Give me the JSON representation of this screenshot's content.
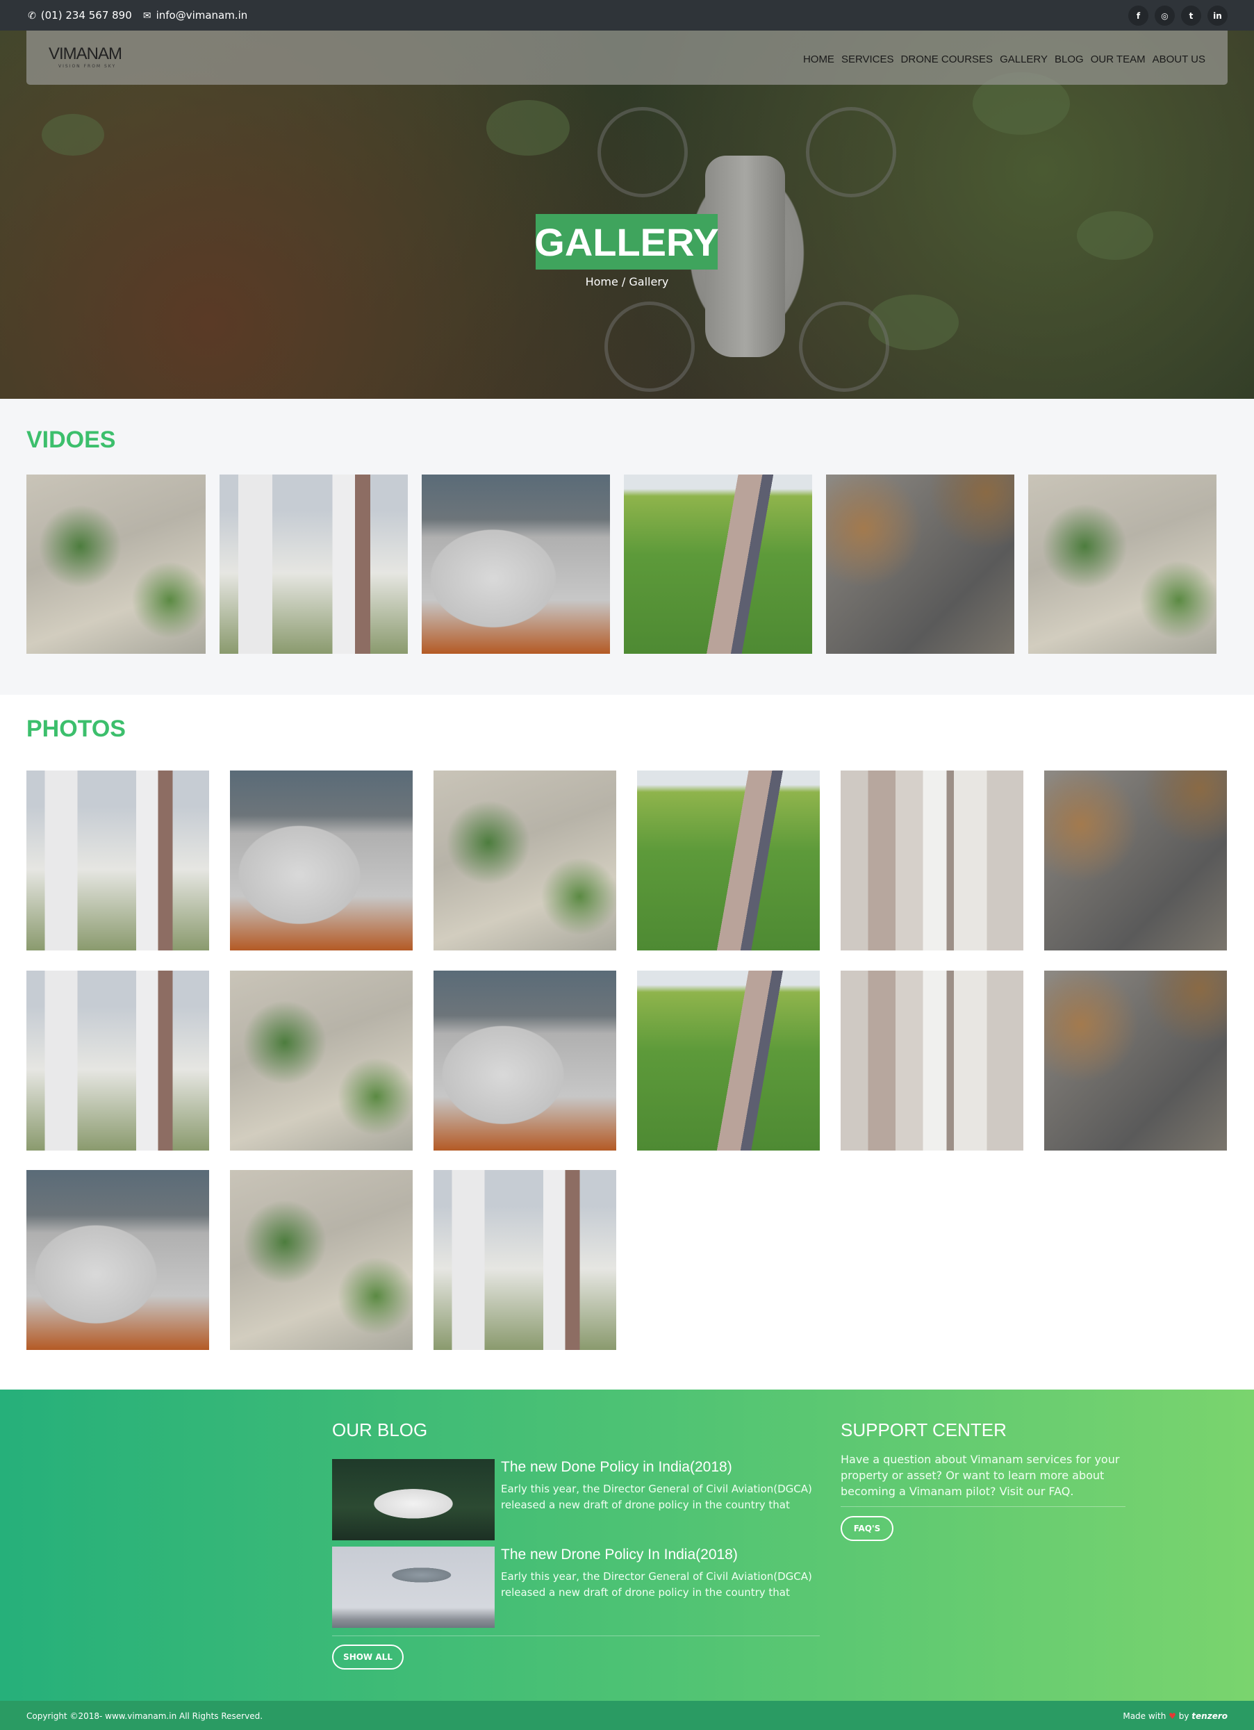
{
  "topbar": {
    "phone": "(01) 234 567 890",
    "email": "info@vimanam.in",
    "phone_icon": "phone-icon",
    "email_icon": "envelope-icon",
    "social": [
      {
        "icon": "facebook-icon",
        "glyph": "f"
      },
      {
        "icon": "instagram-icon",
        "glyph": "◎"
      },
      {
        "icon": "twitter-icon",
        "glyph": "t"
      },
      {
        "icon": "linkedin-icon",
        "glyph": "in"
      }
    ]
  },
  "nav": {
    "logo": "VIMANAM",
    "logo_tagline": "VISION FROM SKY",
    "items": [
      "HOME",
      "SERVICES",
      "DRONE COURSES",
      "GALLERY",
      "BLOG",
      "OUR TEAM",
      "ABOUT US"
    ]
  },
  "hero": {
    "title": "GALLERY",
    "breadcrumb": "Home / Gallery"
  },
  "videos": {
    "title": "VIDOES",
    "items": [
      "city",
      "tower",
      "turbine",
      "road",
      "quarry",
      "city"
    ]
  },
  "photos": {
    "title": "PHOTOS",
    "items": [
      "tower",
      "turbine",
      "city",
      "road",
      "tall",
      "quarry",
      "tower",
      "city",
      "turbine",
      "road",
      "tall",
      "quarry",
      "turbine",
      "city",
      "tower"
    ]
  },
  "footer": {
    "blog_title": "OUR BLOG",
    "posts": [
      {
        "title": "The new Done Policy in India(2018)",
        "excerpt": "Early this year, the Director General of Civil Aviation(DGCA) released a new draft of drone policy in the country that"
      },
      {
        "title": "The new Drone Policy In India(2018)",
        "excerpt": "Early this year, the Director General of Civil Aviation(DGCA) released a new draft of drone policy in the country that"
      }
    ],
    "show_all": "SHOW ALL",
    "support_title": "SUPPORT CENTER",
    "support_text": "Have a question about Vimanam services for your property or asset? Or want to learn more about becoming a Vimanam pilot? Visit our FAQ.",
    "faq_button": "FAQ'S"
  },
  "bottombar": {
    "copyright": "Copyright ©2018- www.vimanam.in All Rights Reserved.",
    "made_with": "Made with",
    "by": "by",
    "brand": "tenzero"
  },
  "colors": {
    "accent": "#3cbf6c",
    "topbar": "#2f3439",
    "title_bg": "#3fa45d"
  }
}
